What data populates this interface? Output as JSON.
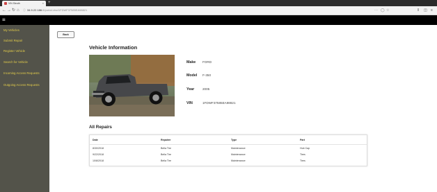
{
  "browser": {
    "tab_title": "VIN Sleuth",
    "tab_close": "×",
    "new_tab": "+",
    "url_host": "34.9.22.186",
    "url_path": ":8/portal.vinc/1FDWF37585EA98821",
    "back": "←",
    "forward": "→",
    "reload": "↻",
    "home": "⌂",
    "icons": [
      "back-arrow-icon",
      "forward-arrow-icon",
      "reload-icon",
      "home-icon",
      "lock-icon",
      "more-icon",
      "shield-icon",
      "star-icon",
      "library-icon",
      "sidebar-icon",
      "menu-icon"
    ]
  },
  "app": {
    "menu_icon": "hamburger-menu-icon"
  },
  "sidebar": {
    "items": [
      {
        "label": "My Vehicles"
      },
      {
        "label": "Submit Repair"
      },
      {
        "label": "Register Vehicle"
      },
      {
        "label": "Search for Vehicle"
      },
      {
        "label": "Incoming Access Requests"
      },
      {
        "label": "Outgoing Access Requests"
      }
    ],
    "text_color": "#e2cc4a",
    "bg_color": "#53534a"
  },
  "main": {
    "back_label": "Back",
    "title": "Vehicle Information",
    "vehicle": {
      "make_label": "Make",
      "make": "FORD",
      "model_label": "Model",
      "model": "F-350",
      "year_label": "Year",
      "year": "2005",
      "vin_label": "VIN",
      "vin": "1FDWF37585EA98821"
    },
    "repairs_title": "All Repairs",
    "repairs_columns": [
      "Date",
      "Repairer",
      "Type",
      "Part"
    ],
    "repairs": [
      {
        "date": "8/30/2018",
        "repairer": "Bella Tire",
        "type": "Maintenance",
        "part": "Hub Cap"
      },
      {
        "date": "9/22/2018",
        "repairer": "Bella Tire",
        "type": "Maintenance",
        "part": "Tires"
      },
      {
        "date": "10/8/2018",
        "repairer": "Bella Tire",
        "type": "Maintenance",
        "part": "Tires"
      }
    ]
  }
}
